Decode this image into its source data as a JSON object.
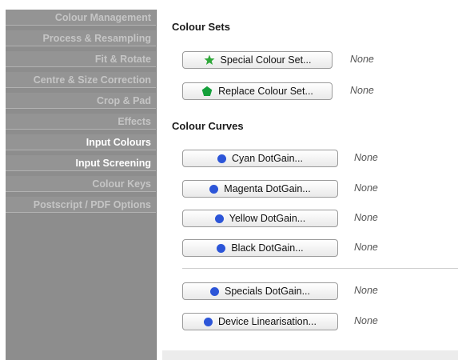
{
  "sidebar": {
    "items": [
      {
        "label": "Colour Management",
        "active": false
      },
      {
        "label": "Process & Resampling",
        "active": false
      },
      {
        "label": "Fit & Rotate",
        "active": false
      },
      {
        "label": "Centre & Size Correction",
        "active": false
      },
      {
        "label": "Crop & Pad",
        "active": false
      },
      {
        "label": "Effects",
        "active": false
      },
      {
        "label": "Input Colours",
        "active": true
      },
      {
        "label": "Input Screening",
        "active": true
      },
      {
        "label": "Colour Keys",
        "active": false
      },
      {
        "label": "Postscript / PDF Options",
        "active": false
      }
    ]
  },
  "main": {
    "colour_sets": {
      "title": "Colour Sets",
      "special": {
        "label": "Special Colour Set...",
        "value": "None",
        "icon": "star-icon",
        "icon_color": "#2fa83a"
      },
      "replace": {
        "label": "Replace Colour Set...",
        "value": "None",
        "icon": "pentagon-icon",
        "icon_color": "#14a03a"
      }
    },
    "colour_curves": {
      "title": "Colour Curves",
      "cyan": {
        "label": "Cyan DotGain...",
        "value": "None"
      },
      "magenta": {
        "label": "Magenta DotGain...",
        "value": "None"
      },
      "yellow": {
        "label": "Yellow DotGain...",
        "value": "None"
      },
      "black": {
        "label": "Black DotGain...",
        "value": "None"
      },
      "specials": {
        "label": "Specials DotGain...",
        "value": "None"
      },
      "device": {
        "label": "Device Linearisation...",
        "value": "None"
      },
      "dot_color": "#2c55d8"
    }
  }
}
